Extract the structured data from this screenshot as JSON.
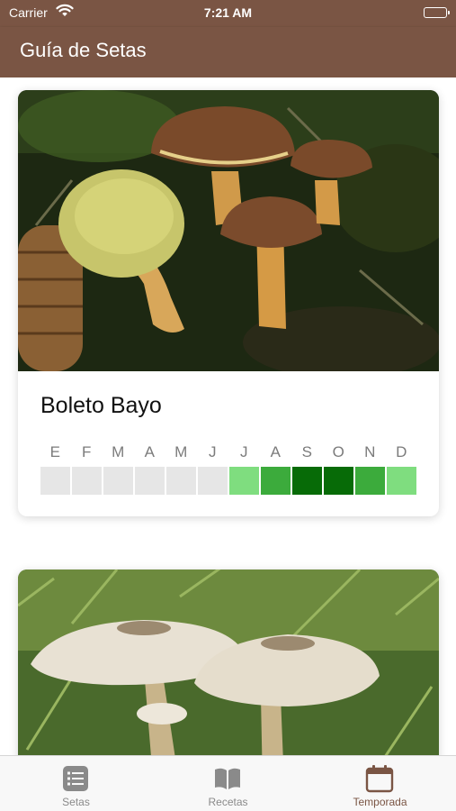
{
  "status_bar": {
    "carrier": "Carrier",
    "time": "7:21 AM"
  },
  "nav": {
    "title": "Guía de Setas"
  },
  "cards": [
    {
      "name": "Boleto Bayo",
      "months": [
        {
          "label": "E",
          "color": "#e6e6e6"
        },
        {
          "label": "F",
          "color": "#e6e6e6"
        },
        {
          "label": "M",
          "color": "#e6e6e6"
        },
        {
          "label": "A",
          "color": "#e6e6e6"
        },
        {
          "label": "M",
          "color": "#e6e6e6"
        },
        {
          "label": "J",
          "color": "#e6e6e6"
        },
        {
          "label": "J",
          "color": "#7fdd7f"
        },
        {
          "label": "A",
          "color": "#3cab3c"
        },
        {
          "label": "S",
          "color": "#076b07"
        },
        {
          "label": "O",
          "color": "#076b07"
        },
        {
          "label": "N",
          "color": "#3cab3c"
        },
        {
          "label": "D",
          "color": "#7fdd7f"
        }
      ]
    }
  ],
  "tabs": [
    {
      "label": "Setas",
      "icon": "list-icon",
      "active": false
    },
    {
      "label": "Recetas",
      "icon": "book-icon",
      "active": false
    },
    {
      "label": "Temporada",
      "icon": "calendar-icon",
      "active": true
    }
  ],
  "colors": {
    "brand": "#7a5544",
    "tab_active": "#7a5544",
    "tab_inactive": "#8a8a8a",
    "season_none": "#e6e6e6",
    "season_low": "#7fdd7f",
    "season_mid": "#3cab3c",
    "season_high": "#076b07"
  }
}
